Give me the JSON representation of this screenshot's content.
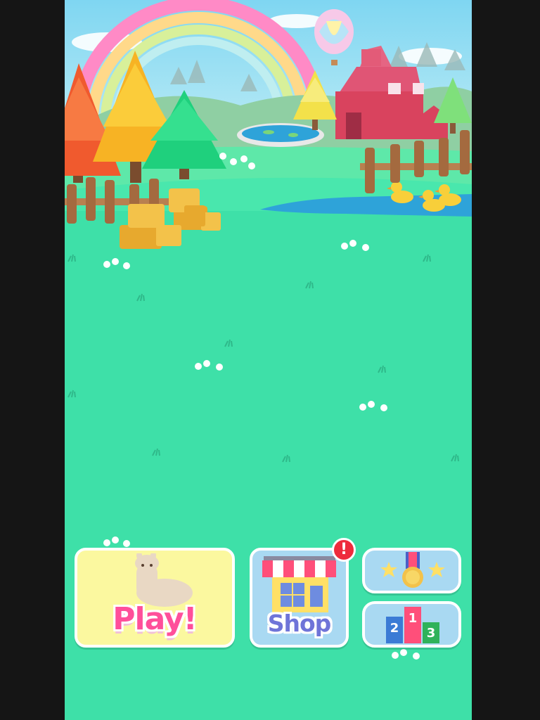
{
  "menu": {
    "play_label": "Play!",
    "shop_label": "Shop",
    "shop_badge": "!",
    "podium": [
      "2",
      "1",
      "3"
    ]
  },
  "colors": {
    "grass": "#3ee0a8",
    "play_button_bg": "#fbf89f",
    "side_button_bg": "#a9d9f2",
    "play_text": "#ff4f9a",
    "shop_text": "#6f74d8",
    "badge": "#ee2b3c"
  },
  "icons": [
    "alpaca-icon",
    "storefront-icon",
    "medal-icon",
    "star-icon",
    "podium-icon",
    "notification-badge-icon"
  ]
}
